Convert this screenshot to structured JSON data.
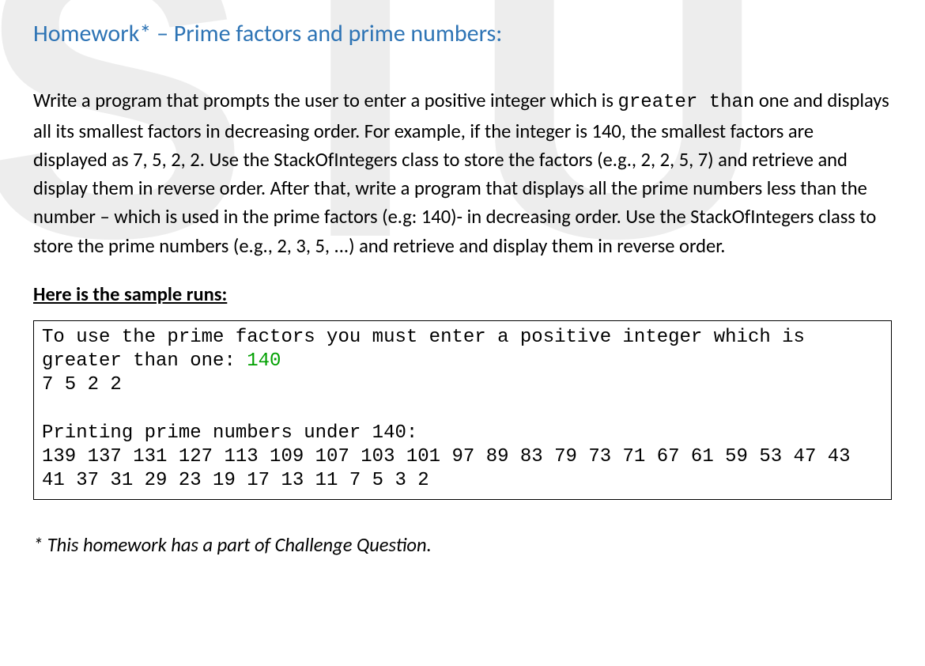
{
  "watermark": "STU",
  "title": "Homework* – Prime factors and prime numbers:",
  "body_pre": "Write a program that prompts the user to enter a positive integer which is ",
  "body_mono1": "greater than",
  "body_mid": " one and displays all its smallest factors in decreasing order. For example, if the integer is 140, the smallest factors are displayed as 7, 5, 2, 2. Use the StackOfIntegers class to store the factors (e.g., 2, 2, 5, 7) and retrieve and display them in reverse order. After that, write a program that displays all the prime numbers less than the number – which is used in the prime factors (e.g: 140)-  in decreasing order. Use the StackOfIntegers class to store the prime numbers (e.g., 2, 3, 5, ...) and retrieve and display them in reverse order.",
  "sample_heading": "Here is the sample runs:",
  "sample": {
    "prompt_line": "To use the prime factors you must enter a positive integer which is greater than one: ",
    "input_value": "140",
    "factors_line": "7 5 2 2",
    "primes_heading": "Printing prime numbers under 140:",
    "primes_line": "139 137 131 127 113 109 107 103 101 97 89 83 79 73 71 67 61 59 53 47 43 41 37 31 29 23 19 17 13 11 7 5 3 2"
  },
  "footnote": "* This homework has a part of Challenge Question."
}
